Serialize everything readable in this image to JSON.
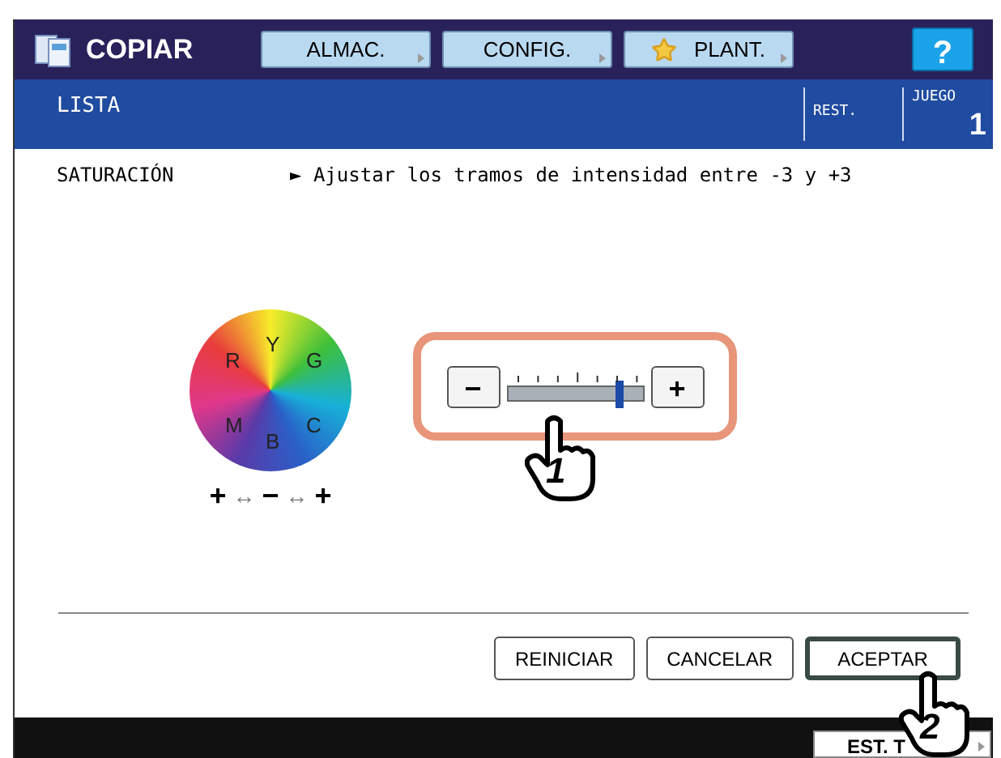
{
  "header": {
    "title": "COPIAR",
    "buttons": [
      {
        "label": "ALMAC.",
        "kind": "plain"
      },
      {
        "label": "CONFIG.",
        "kind": "plain"
      },
      {
        "label": "PLANT.",
        "kind": "star"
      }
    ],
    "help": "?"
  },
  "status": {
    "label": "LISTA",
    "rest": "REST.",
    "set_label": "JUEGO",
    "set_value": "1"
  },
  "setting": {
    "name": "SATURACIÓN",
    "hint": "► Ajustar los tramos de intensidad entre -3 y +3"
  },
  "wheel": {
    "letters": [
      "R",
      "Y",
      "G",
      "M",
      "B",
      "C"
    ],
    "legend": [
      "+",
      "↔",
      "−",
      "↔",
      "+"
    ]
  },
  "slider": {
    "minus": "−",
    "plus": "+",
    "level": 0.833
  },
  "callouts": [
    "1",
    "2"
  ],
  "buttons": [
    {
      "label": "REINICIAR",
      "selected": false
    },
    {
      "label": "CANCELAR",
      "selected": false
    },
    {
      "label": "ACEPTAR",
      "selected": true
    }
  ],
  "footer": {
    "button": "EST. T"
  }
}
